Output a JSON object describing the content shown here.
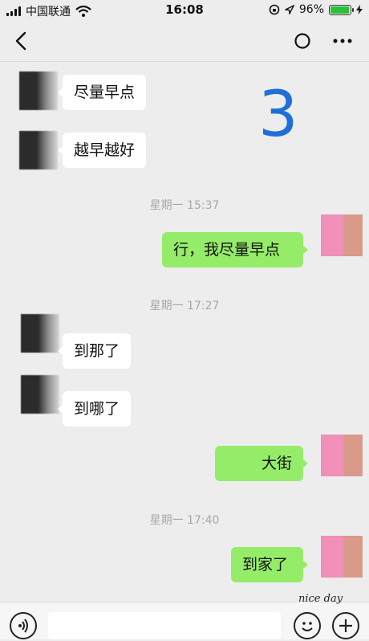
{
  "status_bar": {
    "carrier": "中国联通",
    "time": "16:08",
    "battery_percent_text": "96%",
    "battery_level": 0.96
  },
  "nav": {
    "back_icon": "chevron-left-icon",
    "circle_icon": "circle-icon",
    "more_icon": "more-dots-icon"
  },
  "overlay_number": "3",
  "messages": [
    {
      "side": "in",
      "text": "尽量早点"
    },
    {
      "side": "in",
      "text": "越早越好"
    },
    {
      "side": "time",
      "text": "星期一 15:37"
    },
    {
      "side": "out",
      "text": "行，我尽量早点"
    },
    {
      "side": "time",
      "text": "星期一 17:27"
    },
    {
      "side": "in",
      "text": "到那了"
    },
    {
      "side": "in",
      "text": "到哪了"
    },
    {
      "side": "out",
      "text": "大街"
    },
    {
      "side": "time",
      "text": "星期一 17:40"
    },
    {
      "side": "out",
      "text": "到家了"
    }
  ],
  "input_bar": {
    "voice_icon": "voice-icon",
    "emoji_icon": "emoji-icon",
    "plus_icon": "plus-icon"
  },
  "watermark": "nice day",
  "colors": {
    "background": "#ededed",
    "outgoing_bubble": "#95ec69",
    "incoming_bubble": "#ffffff",
    "overlay_number": "#1e6fd8"
  }
}
